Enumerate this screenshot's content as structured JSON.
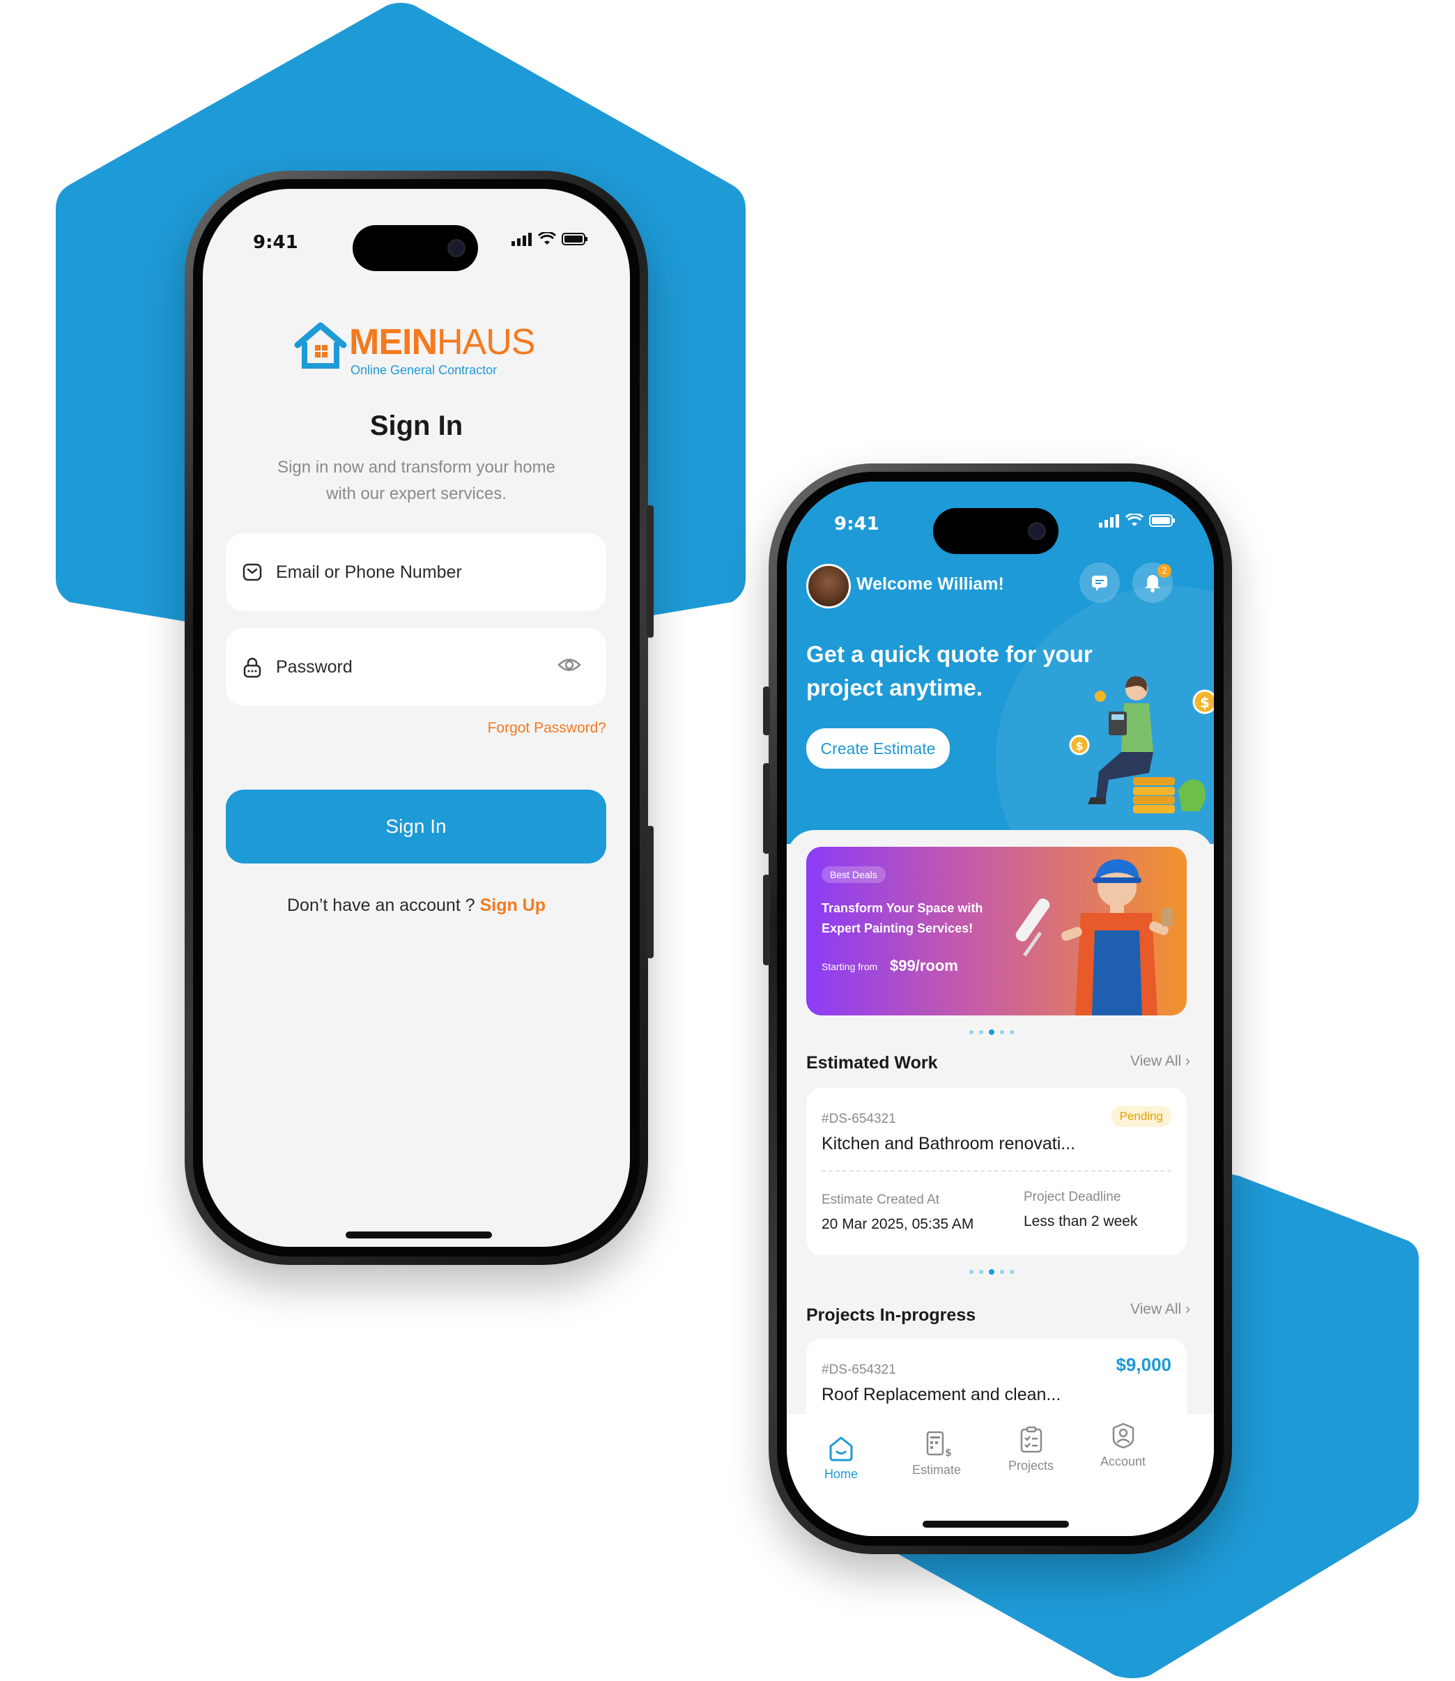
{
  "colors": {
    "brand_blue": "#1e9ad6",
    "brand_orange": "#f47a1f",
    "pending_bg": "#fdf3d6",
    "pending_text": "#e0a400"
  },
  "status": {
    "time": "9:41"
  },
  "signin": {
    "logo": {
      "name_bold": "MEIN",
      "name_light": "HAUS",
      "tagline": "Online General Contractor"
    },
    "title": "Sign In",
    "subtitle_line1": "Sign in now and transform your home",
    "subtitle_line2": "with our expert services.",
    "email_placeholder": "Email or Phone Number",
    "password_placeholder": "Password",
    "forgot_password": "Forgot Password?",
    "signin_button": "Sign In",
    "no_account_text": "Don’t have an account ?",
    "signup_link": "Sign Up"
  },
  "home": {
    "welcome": "Welcome William!",
    "notification_count": "2",
    "hero_line1": "Get a quick quote for your",
    "hero_line2": "project anytime.",
    "create_estimate": "Create Estimate",
    "promo": {
      "tag": "Best Deals",
      "title_line1": "Transform Your Space with",
      "title_line2": "Expert Painting Services!",
      "starting_from": "Starting from",
      "price": "$99/room"
    },
    "estimated_work": {
      "title": "Estimated Work",
      "view_all": "View All",
      "card": {
        "id": "#DS-654321",
        "name": "Kitchen and Bathroom renovati...",
        "status": "Pending",
        "created_label": "Estimate Created At",
        "created_value": "20 Mar 2025, 05:35 AM",
        "deadline_label": "Project Deadline",
        "deadline_value": "Less than 2 week"
      }
    },
    "projects": {
      "title": "Projects In-progress",
      "view_all": "View All",
      "card": {
        "id": "#DS-654321",
        "name": "Roof Replacement and clean...",
        "price": "$9,000"
      }
    },
    "tabs": [
      {
        "label": "Home",
        "icon": "home-icon"
      },
      {
        "label": "Estimate",
        "icon": "estimate-icon"
      },
      {
        "label": "Projects",
        "icon": "projects-icon"
      },
      {
        "label": "Account",
        "icon": "account-icon"
      }
    ]
  }
}
